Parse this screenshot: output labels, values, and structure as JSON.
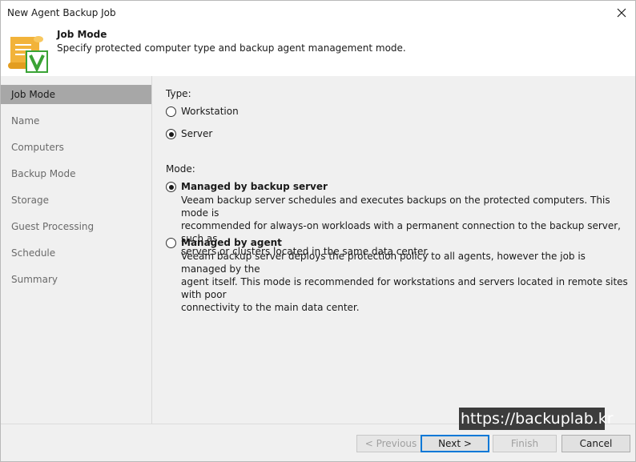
{
  "window": {
    "title": "New Agent Backup Job"
  },
  "header": {
    "title": "Job Mode",
    "subtitle": "Specify protected computer type and backup agent management mode."
  },
  "sidebar": {
    "items": [
      {
        "label": "Job Mode",
        "active": true
      },
      {
        "label": "Name"
      },
      {
        "label": "Computers"
      },
      {
        "label": "Backup Mode"
      },
      {
        "label": "Storage"
      },
      {
        "label": "Guest Processing"
      },
      {
        "label": "Schedule"
      },
      {
        "label": "Summary"
      }
    ]
  },
  "type_section": {
    "label": "Type:",
    "options": [
      {
        "label": "Workstation",
        "checked": false
      },
      {
        "label": "Server",
        "checked": true
      }
    ]
  },
  "mode_section": {
    "label": "Mode:",
    "options": [
      {
        "label": "Managed by backup server",
        "checked": true,
        "desc_lines": [
          "Veeam backup server schedules and executes backups on the protected computers. This mode is",
          "recommended for always-on workloads with a permanent connection to the backup server, such as",
          "servers or clusters located in the same data center."
        ]
      },
      {
        "label": "Managed by agent",
        "checked": false,
        "desc_lines": [
          "Veeam backup server deploys the protection policy to all agents, however the job is managed by the",
          "agent itself. This mode is recommended for workstations and servers located in remote sites with poor",
          "connectivity to the main data center."
        ]
      }
    ]
  },
  "footer": {
    "previous_label": "< Previous",
    "next_label": "Next >",
    "finish_label": "Finish",
    "cancel_label": "Cancel"
  },
  "watermark": "https://backuplab.kr",
  "colors": {
    "sidebar_bg": "#f0f0f0",
    "sidebar_active": "#a7a7a7",
    "logo_scroll": "#f2b33a",
    "logo_check": "#3aa335"
  },
  "icons": {
    "close": "close-icon",
    "logo": "job-scroll-icon"
  }
}
